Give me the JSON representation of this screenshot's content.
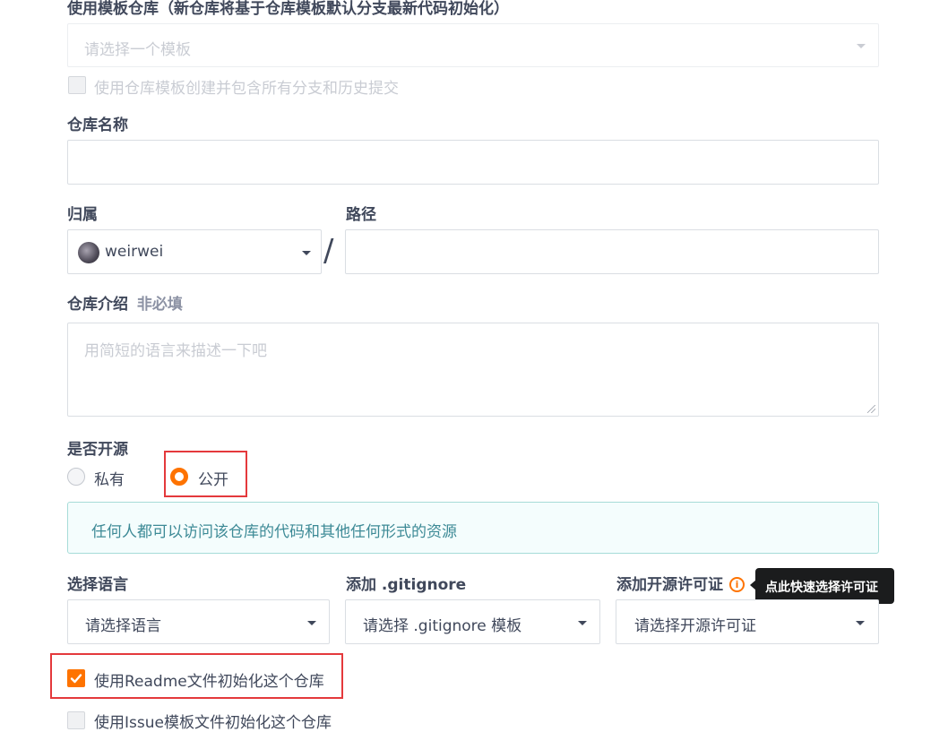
{
  "template": {
    "label": "使用模板仓库（新仓库将基于仓库模板默认分支最新代码初始化）",
    "placeholder": "请选择一个模板",
    "include_all_label": "使用仓库模板创建并包含所有分支和历史提交"
  },
  "repo_name": {
    "label": "仓库名称",
    "value": ""
  },
  "owner": {
    "label": "归属",
    "value": "weirwei"
  },
  "path": {
    "label": "路径",
    "separator": "/",
    "value": ""
  },
  "description": {
    "label": "仓库介绍",
    "optional_tag": "非必填",
    "placeholder": "用简短的语言来描述一下吧"
  },
  "visibility": {
    "label": "是否开源",
    "options": [
      {
        "label": "私有",
        "selected": false
      },
      {
        "label": "公开",
        "selected": true
      }
    ],
    "notice": "任何人都可以访问该仓库的代码和其他任何形式的资源"
  },
  "language": {
    "label": "选择语言",
    "placeholder": "请选择语言"
  },
  "gitignore": {
    "label": "添加 .gitignore",
    "placeholder": "请选择 .gitignore 模板"
  },
  "license": {
    "label": "添加开源许可证",
    "placeholder": "请选择开源许可证",
    "tooltip": "点此快速选择许可证",
    "info_icon": "info-circle-icon"
  },
  "readme": {
    "label": "使用Readme文件初始化这个仓库",
    "checked": true
  },
  "next_option": {
    "label": "使用Issue模板文件初始化这个仓库",
    "checked": false
  },
  "colors": {
    "accent": "#fe7300",
    "highlight_frame": "#e4393c",
    "notice_bg": "#f4fdfd",
    "notice_border": "#a6dcd8",
    "notice_text": "#3d8a96"
  }
}
